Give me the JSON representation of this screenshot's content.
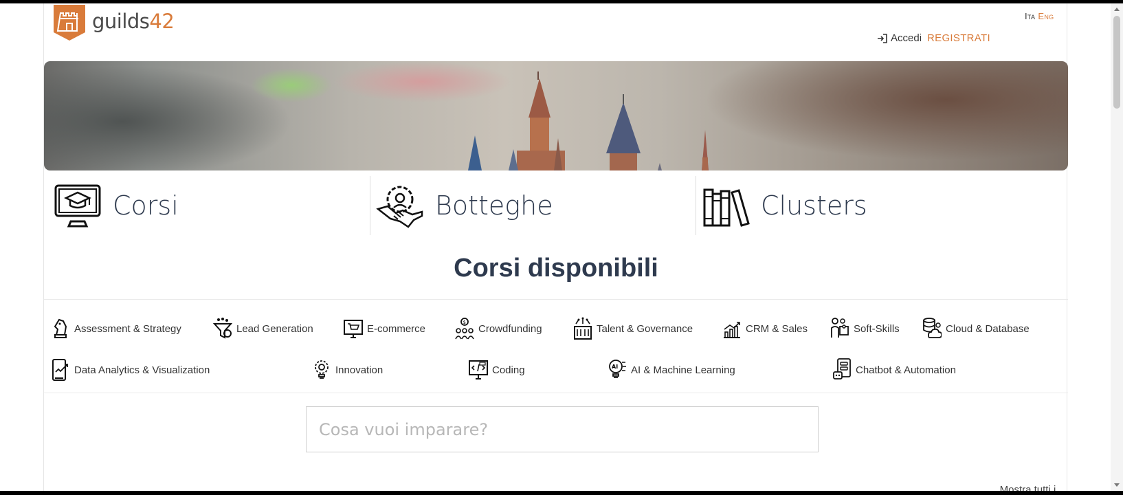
{
  "brand": {
    "name_prefix": "guilds",
    "name_suffix": "42",
    "accent": "#d97b3a",
    "text_dark": "#2e3a4e"
  },
  "header": {
    "lang_ita": "Ita",
    "lang_eng": "Eng",
    "login_label": "Accedi",
    "register_label": "REGISTRATI"
  },
  "tiles": [
    {
      "label": "Corsi",
      "icon": "graduation-monitor-icon"
    },
    {
      "label": "Botteghe",
      "icon": "handshake-gear-icon"
    },
    {
      "label": "Clusters",
      "icon": "books-icon"
    }
  ],
  "section_title": "Corsi disponibili",
  "topics_row1": [
    {
      "label": "Assessment & Strategy",
      "icon": "chess-knight-icon"
    },
    {
      "label": "Lead Generation",
      "icon": "funnel-icon"
    },
    {
      "label": "E-commerce",
      "icon": "cart-monitor-icon"
    },
    {
      "label": "Crowdfunding",
      "icon": "people-money-icon"
    },
    {
      "label": "Talent & Governance",
      "icon": "building-icon"
    },
    {
      "label": "CRM & Sales",
      "icon": "growth-chart-icon"
    },
    {
      "label": "Soft-Skills",
      "icon": "puzzle-people-icon"
    },
    {
      "label": "Cloud & Database",
      "icon": "cloud-database-icon"
    }
  ],
  "topics_row2": [
    {
      "label": "Data Analytics & Visualization",
      "icon": "phone-chart-icon"
    },
    {
      "label": "Innovation",
      "icon": "lightbulb-gear-icon"
    },
    {
      "label": "Coding",
      "icon": "code-monitor-icon"
    },
    {
      "label": "AI & Machine Learning",
      "icon": "ai-bulb-icon"
    },
    {
      "label": "Chatbot & Automation",
      "icon": "chatbot-icon"
    }
  ],
  "search": {
    "placeholder": "Cosa vuoi imparare?"
  },
  "show_all_label": "Mostra tutti i corsi"
}
